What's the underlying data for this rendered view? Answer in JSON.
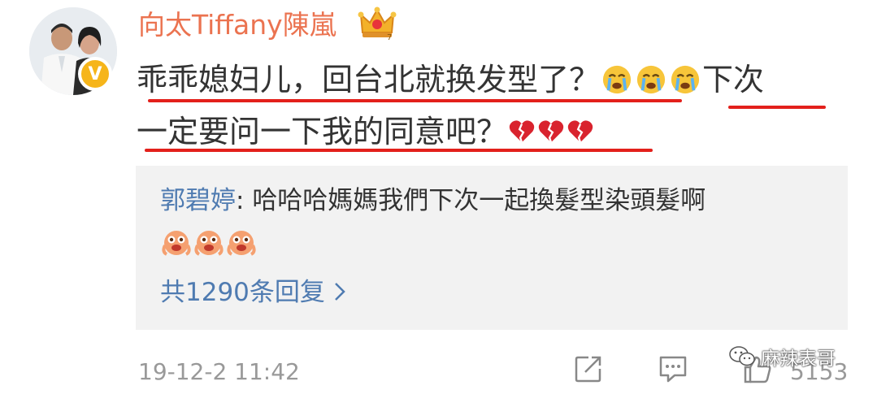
{
  "comment": {
    "username": "向太Tiffany陳嵐",
    "text_line1": "乖乖媳妇儿，回台北就换发型了？",
    "text_line1_tail": "下次",
    "text_line2": "一定要问一下我的同意吧？",
    "cry_emoji_count": 3,
    "broken_heart_count": 3,
    "timestamp": "19-12-2 11:42",
    "like_count": "5153",
    "verify_mark": "V"
  },
  "reply": {
    "author": "郭碧婷",
    "separator": ": ",
    "text": "哈哈哈媽媽我們下次一起換髮型染頭髮啊",
    "laugh_emoji_count": 3,
    "count_label": "共1290条回复"
  },
  "watermark": {
    "text": "麻辣表哥"
  },
  "colors": {
    "username": "#eb7350",
    "link_blue": "#4f7bb1",
    "highlight_red": "#e3201b",
    "meta_gray": "#999999",
    "verify_gold": "#f6b51a"
  }
}
